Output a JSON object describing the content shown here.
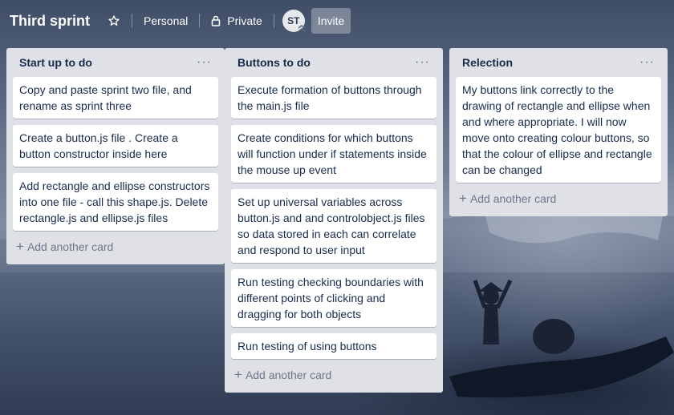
{
  "header": {
    "board_title": "Third sprint",
    "team_label": "Personal",
    "visibility_label": "Private",
    "avatar_initials": "ST",
    "invite_label": "Invite"
  },
  "lists": [
    {
      "title": "Start up to do",
      "menu": "···",
      "cards": [
        "Copy and paste sprint two file, and rename as sprint three",
        "Create a button.js file . Create a button constructor inside here",
        "Add rectangle and ellipse constructors into one file - call this shape.js. Delete rectangle.js and ellipse.js files"
      ],
      "add_card_label": "Add another card"
    },
    {
      "title": "Buttons to do",
      "menu": "···",
      "cards": [
        "Execute formation of buttons through the main.js file",
        "Create conditions for which buttons will function under if statements inside the mouse up event",
        "Set up universal variables across button.js and and controlobject.js files so data stored in each can correlate and respond to user input",
        "Run testing checking boundaries with different points of clicking and dragging for both objects",
        "Run testing of using buttons"
      ],
      "add_card_label": "Add another card"
    },
    {
      "title": "Relection",
      "menu": "···",
      "cards": [
        "My buttons link correctly to the drawing of rectangle and ellipse when and where appropriate. I will now move onto creating colour buttons, so that the colour of ellipse and rectangle can be changed"
      ],
      "add_card_label": "Add another card"
    }
  ],
  "icons": {
    "star": "star-icon",
    "lock": "lock-icon",
    "plus": "plus-icon"
  },
  "colors": {
    "list_bg": "#dfe1e6",
    "card_bg": "#ffffff",
    "text": "#172b4d",
    "muted": "#6b778c"
  }
}
